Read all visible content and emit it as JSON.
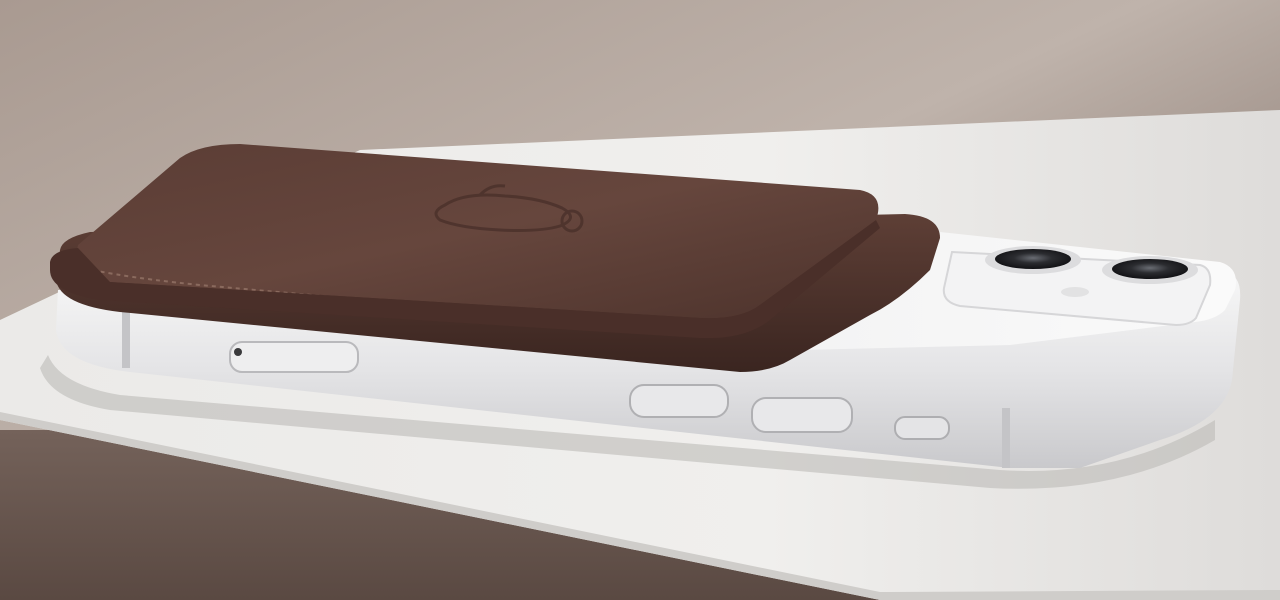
{
  "image": {
    "subject": "product-photo",
    "objects": [
      "wooden-table",
      "white-paper-sheet",
      "white-smartphone",
      "brown-leather-wallet",
      "apple-logo-emboss",
      "dual-camera"
    ]
  },
  "palette": {
    "table_light": "#b7a9a1",
    "table_dark": "#6b5a52",
    "paper": "#e9e8e6",
    "phone_frame": "#f1f1f1",
    "phone_shadow": "#c9c9cb",
    "leather": "#5e3f36",
    "leather_dark": "#3b241f",
    "lens": "#2a2a2c"
  }
}
